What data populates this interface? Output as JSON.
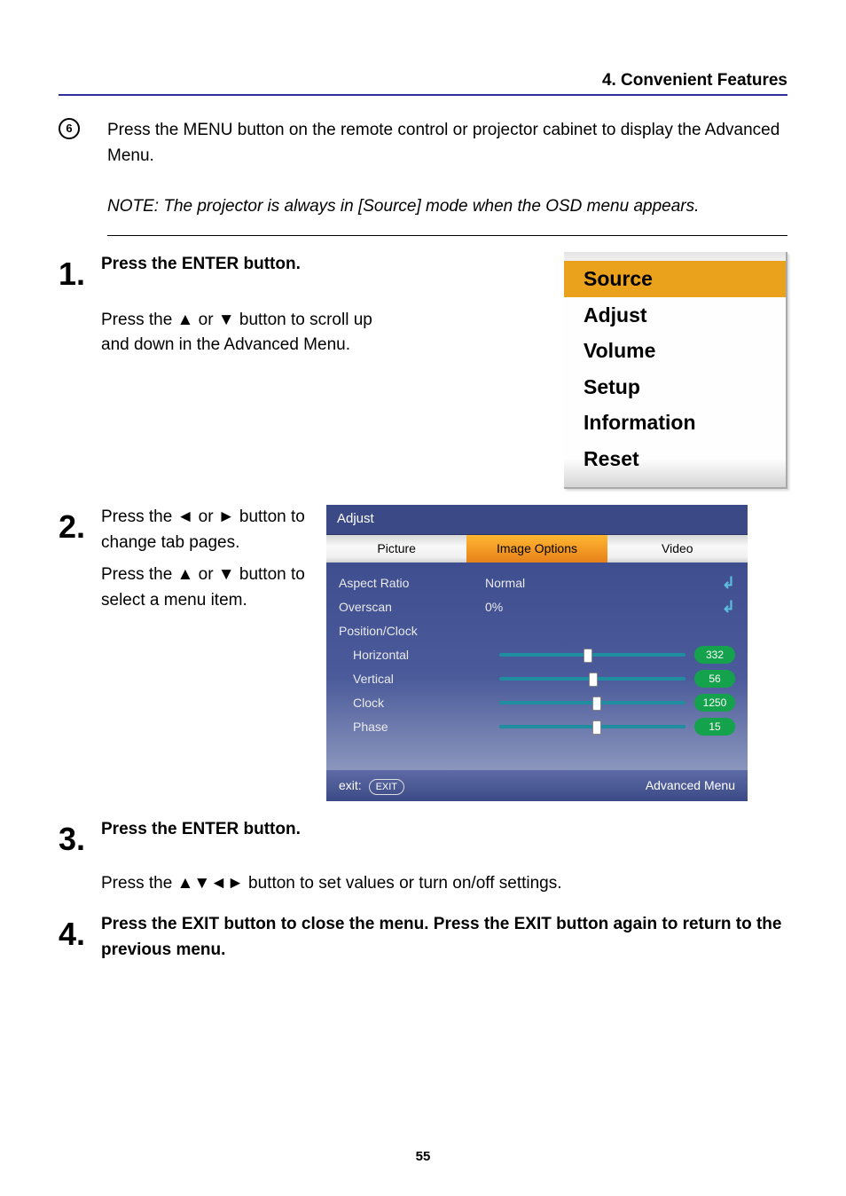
{
  "header": {
    "section_title": "4. Convenient Features"
  },
  "intro": {
    "bullet_num": "6",
    "p1": "Press the MENU button on the remote control or projector cabinet to display the Advanced Menu.",
    "note": "NOTE: The projector is always in [Source] mode when the OSD menu appears."
  },
  "steps": {
    "s1": {
      "num": "1.",
      "line1": "Press the ENTER button.",
      "line2": "Press the ▲ or ▼ button to scroll up and down in the Advanced Menu.",
      "menu": {
        "items": [
          "Source",
          "Adjust",
          "Volume",
          "Setup",
          "Information",
          "Reset"
        ],
        "selected": 0
      }
    },
    "s2": {
      "num": "2.",
      "line1": "Press the ◄ or ► button to change tab pages.",
      "line2": "Press the ▲ or ▼ button to select a menu item.",
      "panel": {
        "title": "Adjust",
        "tabs": [
          "Picture",
          "Image Options",
          "Video"
        ],
        "selected_tab": 1,
        "rows": {
          "aspect": {
            "label": "Aspect Ratio",
            "value": "Normal"
          },
          "overscan": {
            "label": "Overscan",
            "value": "0%"
          },
          "pc": {
            "label": "Position/Clock"
          },
          "horiz": {
            "label": "Horizontal",
            "val": "332",
            "pos": "45%"
          },
          "vert": {
            "label": "Vertical",
            "val": "56",
            "pos": "48%"
          },
          "clock": {
            "label": "Clock",
            "val": "1250",
            "pos": "50%"
          },
          "phase": {
            "label": "Phase",
            "val": "15",
            "pos": "50%"
          }
        },
        "footer": {
          "exit_label": "exit:",
          "exit_btn": "EXIT",
          "mode": "Advanced Menu"
        }
      }
    },
    "s3": {
      "num": "3.",
      "line1": "Press the ENTER button.",
      "line2": "Press the ▲▼◄► button to set values or turn on/off settings."
    },
    "s4": {
      "num": "4.",
      "p": "Press the EXIT button to close the menu. Press the EXIT button again to return to the previous menu."
    }
  },
  "page_number": "55"
}
